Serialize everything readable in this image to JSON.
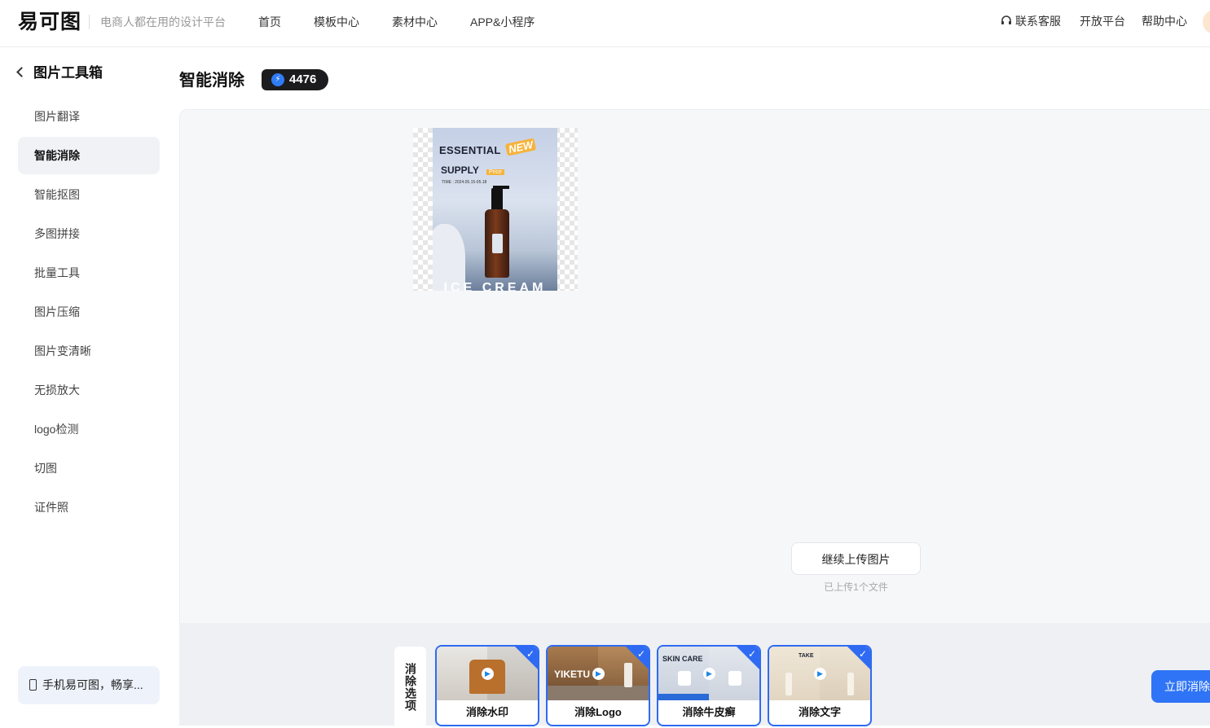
{
  "header": {
    "logo": "易可图",
    "slogan": "电商人都在用的设计平台",
    "nav": [
      "首页",
      "模板中心",
      "素材中心",
      "APP&小程序"
    ],
    "support": "联系客服",
    "open_platform": "开放平台",
    "help": "帮助中心"
  },
  "sidebar": {
    "title": "图片工具箱",
    "items": [
      "图片翻译",
      "智能消除",
      "智能抠图",
      "多图拼接",
      "批量工具",
      "图片压缩",
      "图片变清晰",
      "无损放大",
      "logo检测",
      "切图",
      "证件照"
    ],
    "active_index": 1,
    "mobile_promo": "手机易可图，畅享..."
  },
  "main": {
    "title": "智能消除",
    "credits": "4476",
    "poster": {
      "line1": "ESSENTIAL",
      "badge": "NEW",
      "line2": "SUPPLY",
      "price": "Price",
      "time": "TIME : 2024.05.15-05.18",
      "footer": "ICE CREAM"
    },
    "upload_more": "继续上传图片",
    "upload_note": "已上传1个文件"
  },
  "options": {
    "label": "消除选项",
    "cards": [
      {
        "caption": "消除水印",
        "thumb_text": ""
      },
      {
        "caption": "消除Logo",
        "thumb_text": "YIKETU"
      },
      {
        "caption": "消除牛皮癣",
        "thumb_text": "SKIN CARE"
      },
      {
        "caption": "消除文字",
        "thumb_text": "TAKE"
      }
    ],
    "go_button": "立即消除"
  },
  "colors": {
    "accent": "#2f74f6",
    "card_border": "#2f6bf2",
    "active_item_bg": "#f0f2f6"
  }
}
